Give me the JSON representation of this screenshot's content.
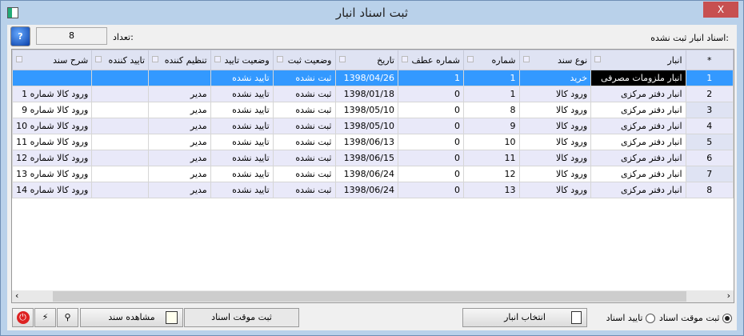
{
  "window": {
    "title": "ثبت اسناد انبار",
    "close": "X"
  },
  "top": {
    "list_label": "اسناد انبار ثبت نشده:",
    "count_label": "تعداد:",
    "count_value": "8",
    "help": "?"
  },
  "grid": {
    "columns": [
      "*",
      "انبار",
      "نوع سند",
      "شماره",
      "شماره عطف",
      "تاریخ",
      "وضعیت ثبت",
      "وضعیت تایید",
      "تنظیم کننده",
      "تایید کننده",
      "شرح سند"
    ],
    "rows": [
      [
        "1",
        "انبار ملزومات مصرفی",
        "خرید",
        "1",
        "1",
        "1398/04/26",
        "ثبت نشده",
        "تایید نشده",
        "",
        "",
        ""
      ],
      [
        "2",
        "انبار دفتر مرکزی",
        "ورود کالا",
        "1",
        "0",
        "1398/01/18",
        "ثبت نشده",
        "تایید نشده",
        "مدیر",
        "",
        "ورود کالا شماره 1"
      ],
      [
        "3",
        "انبار دفتر مرکزی",
        "ورود کالا",
        "8",
        "0",
        "1398/05/10",
        "ثبت نشده",
        "تایید نشده",
        "مدیر",
        "",
        "ورود کالا شماره 9"
      ],
      [
        "4",
        "انبار دفتر مرکزی",
        "ورود کالا",
        "9",
        "0",
        "1398/05/10",
        "ثبت نشده",
        "تایید نشده",
        "مدیر",
        "",
        "ورود کالا شماره 10"
      ],
      [
        "5",
        "انبار دفتر مرکزی",
        "ورود کالا",
        "10",
        "0",
        "1398/06/13",
        "ثبت نشده",
        "تایید نشده",
        "مدیر",
        "",
        "ورود کالا شماره 11"
      ],
      [
        "6",
        "انبار دفتر مرکزی",
        "ورود کالا",
        "11",
        "0",
        "1398/06/15",
        "ثبت نشده",
        "تایید نشده",
        "مدیر",
        "",
        "ورود کالا شماره 12"
      ],
      [
        "7",
        "انبار دفتر مرکزی",
        "ورود کالا",
        "12",
        "0",
        "1398/06/24",
        "ثبت نشده",
        "تایید نشده",
        "مدیر",
        "",
        "ورود کالا شماره 13"
      ],
      [
        "8",
        "انبار دفتر مرکزی",
        "ورود کالا",
        "13",
        "0",
        "1398/06/24",
        "ثبت نشده",
        "تایید نشده",
        "مدیر",
        "",
        "ورود کالا شماره 14"
      ]
    ],
    "selected_row": 0
  },
  "bottom": {
    "radio_temp": "ثبت موقت اسناد",
    "radio_approve": "تایید اسناد",
    "radio_selected": "temp",
    "select_warehouse": "انتخاب انبار",
    "temp_register": "ثبت موقت اسناد",
    "view_doc": "مشاهده سند"
  },
  "colors": {
    "selection": "#3399ff",
    "title_bar": "#b9d1ea",
    "close": "#c75050"
  }
}
